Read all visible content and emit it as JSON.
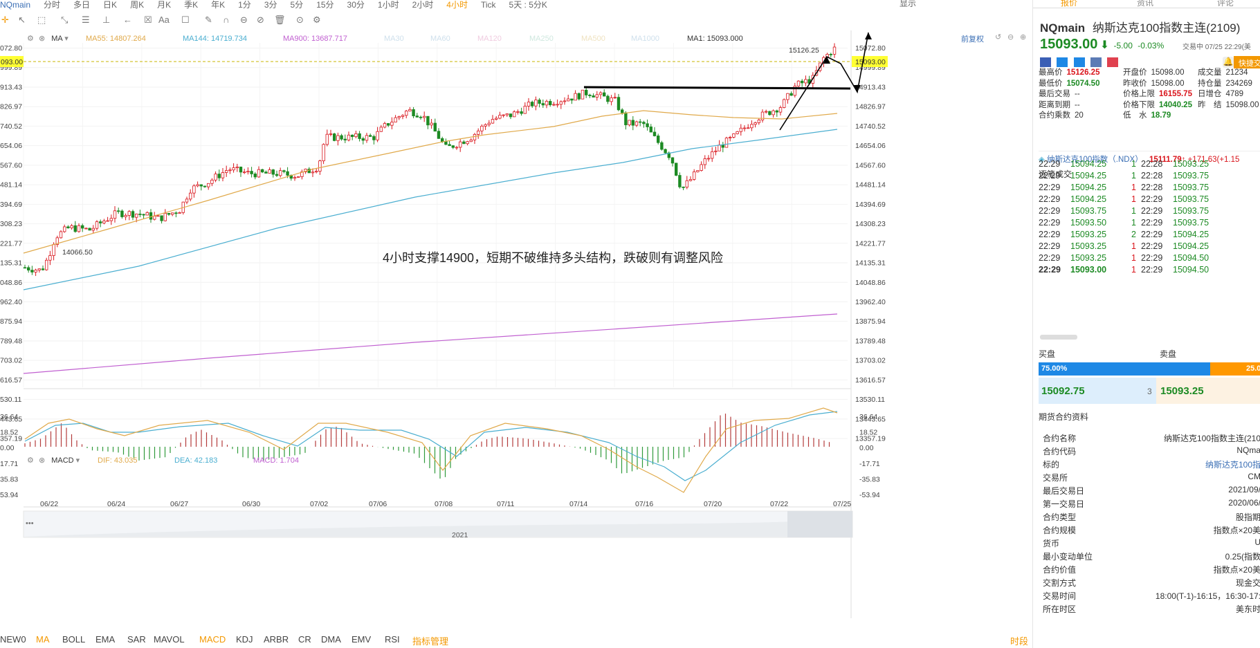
{
  "topbar": {
    "items": [
      "NQmain",
      "分时",
      "多日",
      "日K",
      "周K",
      "月K",
      "季K",
      "年K",
      "1分",
      "3分",
      "5分",
      "15分",
      "30分",
      "1小时",
      "2小时",
      "4小时",
      "Tick",
      "5天 : 5分K"
    ],
    "active": "4小时",
    "right_label": "显示"
  },
  "legend": {
    "settings_icon": "gear-icon",
    "close_icon": "close-icon",
    "indicator": "MA",
    "ma55": "MA55: 14807.264",
    "ma144": "MA144: 14719.734",
    "ma900": "MA900: 13687.717",
    "inactive": [
      "MA30",
      "MA60",
      "MA120",
      "MA250",
      "MA500",
      "MA1000"
    ],
    "ma1": "MA1: 15093.000",
    "adjust_label": "前复权"
  },
  "price_axis": {
    "ticks": [
      "15072.80",
      "14999.89",
      "14913.43",
      "14826.97",
      "14740.52",
      "14654.06",
      "14567.60",
      "14481.14",
      "14394.69",
      "14308.23",
      "14221.77",
      "14135.31",
      "14048.86",
      "13962.40",
      "13875.94",
      "13789.48",
      "13703.02",
      "13616.57",
      "13530.11",
      "13443.65",
      "13357.19"
    ],
    "current": "15093.00",
    "current_left": "093.00"
  },
  "annotations": {
    "high": "15126.25",
    "low": "14066.50",
    "note": "4小时支撑14900，短期不破维持多头结构，跌破则有调整风险"
  },
  "macd": {
    "indicator": "MACD",
    "dif": "DIF: 43.035",
    "dea": "DEA: 42.183",
    "macd": "MACD: 1.704",
    "ticks": [
      "36.64",
      "18.52",
      "0.00",
      "-17.71",
      "-35.83",
      "-53.94"
    ]
  },
  "x_axis": {
    "dates": [
      "06/22",
      "06/24",
      "06/27",
      "06/30",
      "07/02",
      "07/06",
      "07/08",
      "07/11",
      "07/14",
      "07/16",
      "07/20",
      "07/22",
      "07/25"
    ],
    "year": "2021"
  },
  "bottom_tabs": {
    "items": [
      "NEW0",
      "MA",
      "BOLL",
      "EMA",
      "SAR",
      "MAVOL",
      "MACD",
      "KDJ",
      "ARBR",
      "CR",
      "DMA",
      "EMV",
      "RSI",
      "指标管理"
    ],
    "right": "时段"
  },
  "right_panel": {
    "tabs": [
      "报价",
      "资讯",
      "评论"
    ],
    "symbol": "NQmain",
    "name": "纳斯达克100指数主连(2109)",
    "price": "15093.00",
    "change": "-5.00",
    "change_pct": "-0.03%",
    "status": "交易中 07/25 22:29(美",
    "quick_trade": "快捷交",
    "stats": [
      {
        "k": "最高价",
        "v": "15126.25",
        "c": "red"
      },
      {
        "k": "开盘价",
        "v": "15098.00",
        "c": "blk"
      },
      {
        "k": "成交量",
        "v": "21234",
        "c": "blk"
      },
      {
        "k": "最低价",
        "v": "15074.50",
        "c": "green"
      },
      {
        "k": "昨收价",
        "v": "15098.00",
        "c": "blk"
      },
      {
        "k": "持仓量",
        "v": "234269",
        "c": "blk"
      },
      {
        "k": "最后交易",
        "v": "--",
        "c": "blk"
      },
      {
        "k": "价格上限",
        "v": "16155.75",
        "c": "red"
      },
      {
        "k": "日增仓",
        "v": "4789",
        "c": "blk"
      },
      {
        "k": "距离到期",
        "v": "--",
        "c": "blk"
      },
      {
        "k": "价格下限",
        "v": "14040.25",
        "c": "green"
      },
      {
        "k": "昨　结",
        "v": "15098.00",
        "c": "blk"
      },
      {
        "k": "合约乘数",
        "v": "20",
        "c": "blk"
      },
      {
        "k": "低　水",
        "v": "18.79",
        "c": "green"
      }
    ],
    "index_name": "纳斯达克100指数（.NDX）",
    "index_price": "15111.79",
    "index_change": "+171.63(+1.15",
    "trades_title": "逐笔成交",
    "trades": [
      [
        "22:29",
        "15094.25",
        "1",
        "g",
        "22:28",
        "15093.25",
        "g"
      ],
      [
        "22:29",
        "15094.25",
        "1",
        "g",
        "22:28",
        "15093.75",
        "g"
      ],
      [
        "22:29",
        "15094.25",
        "1",
        "r",
        "22:28",
        "15093.75",
        "g"
      ],
      [
        "22:29",
        "15094.25",
        "1",
        "r",
        "22:29",
        "15093.75",
        "g"
      ],
      [
        "22:29",
        "15093.75",
        "1",
        "g",
        "22:29",
        "15093.75",
        "g"
      ],
      [
        "22:29",
        "15093.50",
        "1",
        "g",
        "22:29",
        "15093.75",
        "g"
      ],
      [
        "22:29",
        "15093.25",
        "2",
        "g",
        "22:29",
        "15094.25",
        "g"
      ],
      [
        "22:29",
        "15093.25",
        "1",
        "r",
        "22:29",
        "15094.25",
        "g"
      ],
      [
        "22:29",
        "15093.25",
        "1",
        "r",
        "22:29",
        "15094.50",
        "g"
      ],
      [
        "22:29",
        "15093.00",
        "1",
        "r",
        "22:29",
        "15094.50",
        "g"
      ]
    ],
    "buy_label": "买盘",
    "sell_label": "卖盘",
    "buy_pct": "75.00%",
    "sell_pct": "25.0",
    "buy_ratio": 0.75,
    "bid": "15092.75",
    "bid_size": "3",
    "ask": "15093.25",
    "contract_title": "期货合约资料",
    "contract": [
      {
        "k": "合约名称",
        "v": "纳斯达克100指数主连(210"
      },
      {
        "k": "合约代码",
        "v": "NQma"
      },
      {
        "k": "标的",
        "v": "纳斯达克100指",
        "link": true
      },
      {
        "k": "交易所",
        "v": "CM"
      },
      {
        "k": "最后交易日",
        "v": "2021/09/"
      },
      {
        "k": "第一交易日",
        "v": "2020/06/"
      },
      {
        "k": "合约类型",
        "v": "股指期"
      },
      {
        "k": "合约规模",
        "v": "指数点×20美"
      },
      {
        "k": "货币",
        "v": "U"
      },
      {
        "k": "最小变动单位",
        "v": "0.25(指数"
      },
      {
        "k": "合约价值",
        "v": "指数点×20美"
      },
      {
        "k": "交割方式",
        "v": "现金交"
      },
      {
        "k": "交易时间",
        "v": "18:00(T-1)-16:15，16:30-17:"
      },
      {
        "k": "所在时区",
        "v": "美东时"
      }
    ]
  },
  "colors": {
    "up": "#d9141b",
    "down": "#1c8a23",
    "ma55": "#e0a94a",
    "ma144": "#4aaed0",
    "ma900": "#c05fd0",
    "accent": "#f39800",
    "buy_bar": "#1e88e5",
    "sell_bar": "#ff9800"
  }
}
